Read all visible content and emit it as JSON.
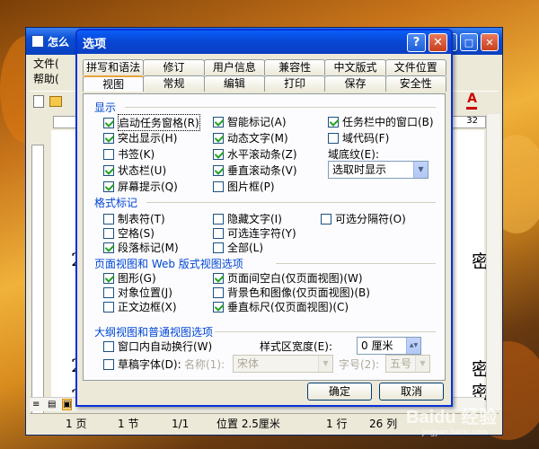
{
  "background_window": {
    "title": "怎么",
    "menu": [
      "文件(",
      "帮助("
    ],
    "ruler_value": "32",
    "doc_text_1": "2",
    "doc_text_2": "密",
    "doc_text_3": "2",
    "doc_text_4": "密",
    "doc_text_5": "2",
    "doc_text_6": "密",
    "status": {
      "page": "1 页",
      "section": "1 节",
      "ratio": "1/1",
      "position": "位置 2.5厘米",
      "row": "1 行",
      "col": "26 列"
    }
  },
  "dialog": {
    "title": "选项",
    "help_label": "?",
    "close_label": "✕",
    "tabs_row1": [
      "拼写和语法",
      "修订",
      "用户信息",
      "兼容性",
      "中文版式",
      "文件位置"
    ],
    "tabs_row2": [
      "视图",
      "常规",
      "编辑",
      "打印",
      "保存",
      "安全性"
    ],
    "active_tab": "视图",
    "display": {
      "label": "显示",
      "items": [
        {
          "label": "启动任务窗格(R)",
          "checked": true
        },
        {
          "label": "智能标记(A)",
          "checked": true
        },
        {
          "label": "任务栏中的窗口(B)",
          "checked": true
        },
        {
          "label": "突出显示(H)",
          "checked": true
        },
        {
          "label": "动态文字(M)",
          "checked": true
        },
        {
          "label": "域代码(F)",
          "checked": false
        },
        {
          "label": "书签(K)",
          "checked": false
        },
        {
          "label": "水平滚动条(Z)",
          "checked": true
        },
        {
          "label": "状态栏(U)",
          "checked": true
        },
        {
          "label": "垂直滚动条(V)",
          "checked": true
        },
        {
          "label": "屏幕提示(Q)",
          "checked": true
        },
        {
          "label": "图片框(P)",
          "checked": false
        }
      ],
      "field_shading_label": "域底纹(E):",
      "field_shading_value": "选取时显示"
    },
    "format_marks": {
      "label": "格式标记",
      "items": [
        {
          "label": "制表符(T)",
          "checked": false
        },
        {
          "label": "隐藏文字(I)",
          "checked": false
        },
        {
          "label": "可选分隔符(O)",
          "checked": false
        },
        {
          "label": "空格(S)",
          "checked": false
        },
        {
          "label": "可选连字符(Y)",
          "checked": false
        },
        {
          "label": "段落标记(M)",
          "checked": true
        },
        {
          "label": "全部(L)",
          "checked": false
        }
      ]
    },
    "print_web": {
      "label": "页面视图和 Web 版式视图选项",
      "items": [
        {
          "label": "图形(G)",
          "checked": true
        },
        {
          "label": "页面间空白(仅页面视图)(W)",
          "checked": true
        },
        {
          "label": "对象位置(J)",
          "checked": false
        },
        {
          "label": "背景色和图像(仅页面视图)(B)",
          "checked": false
        },
        {
          "label": "正文边框(X)",
          "checked": false
        },
        {
          "label": "垂直标尺(仅页面视图)(C)",
          "checked": true
        }
      ]
    },
    "outline": {
      "label": "大纲视图和普通视图选项",
      "wrap_label": "窗口内自动换行(W)",
      "wrap_checked": false,
      "style_width_label": "样式区宽度(E):",
      "style_width_value": "0 厘米",
      "draft_label": "草稿字体(D):",
      "draft_checked": false,
      "name_label": "名称(1):",
      "name_value": "宋体",
      "size_label": "字号(2):",
      "size_value": "五号"
    },
    "ok_label": "确定",
    "cancel_label": "取消"
  },
  "watermark": "Baidu 经验",
  "watermark_url": "jingyan.baidu.com"
}
